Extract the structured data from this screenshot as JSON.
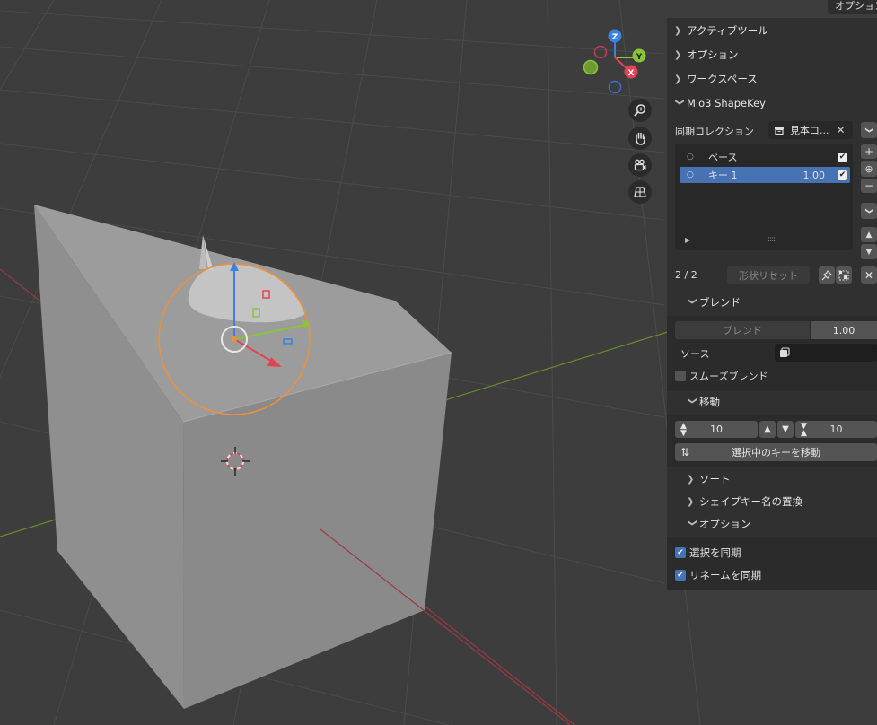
{
  "header": {
    "options_button": "オプション"
  },
  "panel": {
    "sections": [
      {
        "label": "アクティブツール"
      },
      {
        "label": "オプション"
      },
      {
        "label": "ワークスペース"
      },
      {
        "label": "Mio3 ShapeKey"
      }
    ],
    "sync_collection": {
      "label": "同期コレクション",
      "value": "見本コ..."
    },
    "shape_keys": [
      {
        "name": "ベース",
        "value": "",
        "enabled": true,
        "selected": false
      },
      {
        "name": "キー 1",
        "value": "1.00",
        "enabled": true,
        "selected": true
      }
    ],
    "count": "2 / 2",
    "reset_button": "形状リセット",
    "blend": {
      "header": "ブレンド",
      "field_label": "ブレンド",
      "value": "1.00",
      "source_label": "ソース",
      "smooth_label": "スムーズブレンド",
      "smooth_checked": false
    },
    "move": {
      "header": "移動",
      "up_value": "10",
      "down_value": "10",
      "move_button": "選択中のキーを移動"
    },
    "collapsed": [
      {
        "label": "ソート"
      },
      {
        "label": "シェイプキー名の置換"
      }
    ],
    "options": {
      "header": "オプション",
      "sync_selection": "選択を同期",
      "sync_selection_checked": true,
      "sync_rename": "リネームを同期",
      "sync_rename_checked": true
    }
  },
  "axes": {
    "z": "Z",
    "y": "Y",
    "x": "X"
  },
  "colors": {
    "viewport_bg": "#3d3d3d",
    "panel_bg": "#303030",
    "accent": "#4772b3",
    "selection_outline": "#f0903a",
    "x_axis": "#e24455",
    "y_axis": "#8ac43a",
    "z_axis": "#3b82e0"
  }
}
